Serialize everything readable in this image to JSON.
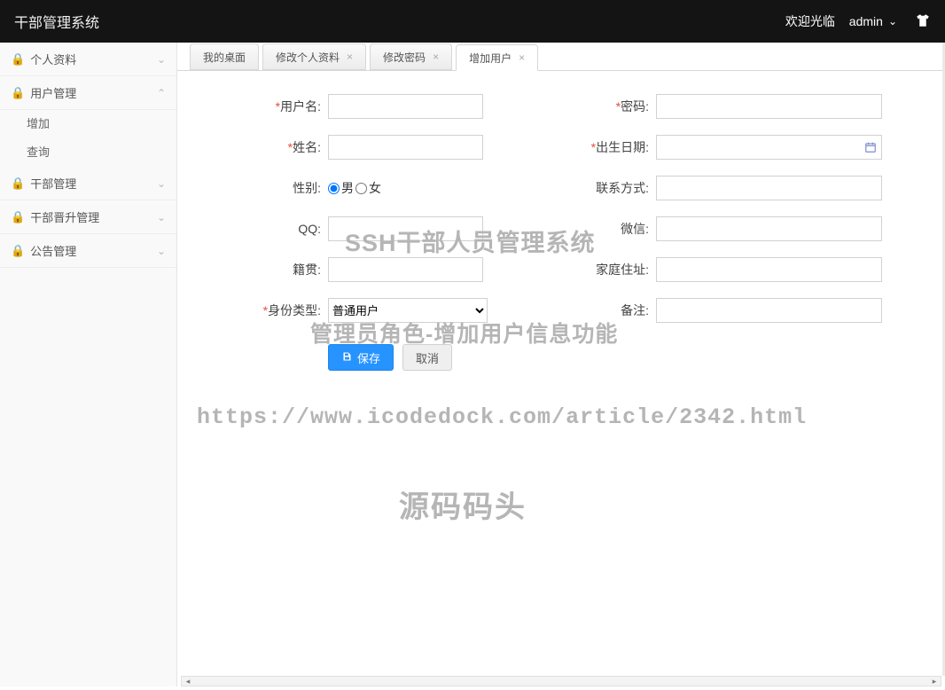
{
  "header": {
    "title": "干部管理系统",
    "welcome": "欢迎光临",
    "user": "admin"
  },
  "sidebar": {
    "items": [
      {
        "label": "个人资料",
        "expanded": false
      },
      {
        "label": "用户管理",
        "expanded": true,
        "children": [
          {
            "label": "增加"
          },
          {
            "label": "查询"
          }
        ]
      },
      {
        "label": "干部管理",
        "expanded": false
      },
      {
        "label": "干部晋升管理",
        "expanded": false
      },
      {
        "label": "公告管理",
        "expanded": false
      }
    ]
  },
  "tabs": [
    {
      "label": "我的桌面",
      "closable": false,
      "active": false
    },
    {
      "label": "修改个人资料",
      "closable": true,
      "active": false
    },
    {
      "label": "修改密码",
      "closable": true,
      "active": false
    },
    {
      "label": "增加用户",
      "closable": true,
      "active": true
    }
  ],
  "form": {
    "username_label": "用户名",
    "password_label": "密码",
    "name_label": "姓名",
    "birthdate_label": "出生日期",
    "gender_label": "性别",
    "contact_label": "联系方式",
    "qq_label": "QQ",
    "wechat_label": "微信",
    "hometown_label": "籍贯",
    "address_label": "家庭住址",
    "identity_label": "身份类型",
    "remark_label": "备注",
    "gender_options": {
      "male": "男",
      "female": "女"
    },
    "gender_selected": "male",
    "identity_options": [
      "普通用户"
    ],
    "identity_selected": "普通用户",
    "values": {
      "username": "",
      "password": "",
      "name": "",
      "birthdate": "",
      "contact": "",
      "qq": "",
      "wechat": "",
      "hometown": "",
      "address": "",
      "remark": ""
    },
    "save_label": "保存",
    "cancel_label": "取消"
  },
  "watermarks": {
    "w1": "SSH干部人员管理系统",
    "w2": "管理员角色-增加用户信息功能",
    "w3": "https://www.icodedock.com/article/2342.html",
    "w4": "源码码头"
  }
}
